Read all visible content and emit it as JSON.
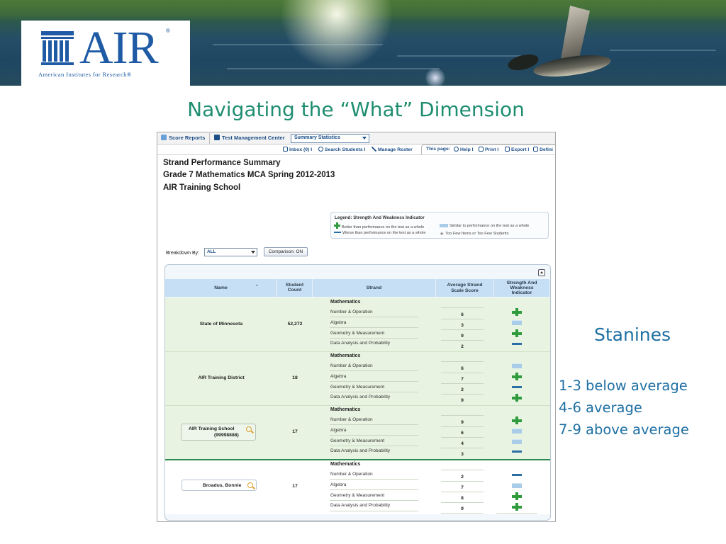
{
  "banner": {
    "logo_word": "AIR",
    "logo_registered": "®",
    "logo_subtitle": "American Institutes for Research®"
  },
  "slide": {
    "title": "Navigating the “What” Dimension",
    "stanines_heading": "Stanines",
    "stanine_ranges": [
      "1-3 below average",
      "4-6 average",
      "7-9 above average"
    ]
  },
  "app": {
    "nav": {
      "score_reports": "Score Reports",
      "test_management": "Test Management Center",
      "report_select": "Summary Statistics"
    },
    "toolbar": {
      "inbox": "Inbox (0) I",
      "search_students": "Search Students I",
      "manage_roster": "Manage Roster",
      "this_page": "This page:",
      "help": "Help I",
      "print": "Print I",
      "export": "Export I",
      "definitions": "Defini"
    },
    "report": {
      "title": "Strand Performance Summary",
      "subtitle": "Grade 7 Mathematics MCA Spring 2012-2013",
      "school": "AIR Training School"
    },
    "legend": {
      "title": "Legend: Strength And Weakness Indicator",
      "better": "Better than performance on the test as a whole",
      "similar": "Similar to performance on the test as a whole",
      "worse": "Worse than performance on the test as a whole",
      "too_few": "Too Few Items or Too Few Students"
    },
    "controls": {
      "breakdown_label": "Breakdown By:",
      "breakdown_value": "ALL",
      "comparison_button": "Comparison: ON"
    },
    "columns": {
      "name": "Name",
      "student_count_1": "Student",
      "student_count_2": "Count",
      "strand": "Strand",
      "avg_1": "Average Strand",
      "avg_2": "Scale Score",
      "sw_1": "Strength And",
      "sw_2": "Weakness",
      "sw_3": "Indicator"
    },
    "groups": [
      {
        "name": "State of Minnesota",
        "code": "",
        "count": "52,272",
        "subject": "Mathematics",
        "rows": [
          {
            "strand": "Number & Operation",
            "score": "6",
            "indicator": "better"
          },
          {
            "strand": "Algebra",
            "score": "3",
            "indicator": "similar"
          },
          {
            "strand": "Geometry & Measurement",
            "score": "9",
            "indicator": "better"
          },
          {
            "strand": "Data Analysis and Probability",
            "score": "2",
            "indicator": "worse"
          }
        ]
      },
      {
        "name": "AIR Training District",
        "code": "",
        "count": "18",
        "subject": "Mathematics",
        "rows": [
          {
            "strand": "Number & Operation",
            "score": "6",
            "indicator": "similar"
          },
          {
            "strand": "Algebra",
            "score": "7",
            "indicator": "better"
          },
          {
            "strand": "Geometry & Measurement",
            "score": "2",
            "indicator": "worse"
          },
          {
            "strand": "Data Analysis and Probability",
            "score": "9",
            "indicator": "better"
          }
        ]
      },
      {
        "name": "AIR Training School",
        "code": "(99998888)",
        "count": "17",
        "subject": "Mathematics",
        "rows": [
          {
            "strand": "Number & Operation",
            "score": "9",
            "indicator": "better"
          },
          {
            "strand": "Algebra",
            "score": "6",
            "indicator": "similar"
          },
          {
            "strand": "Geometry & Measurement",
            "score": "4",
            "indicator": "similar"
          },
          {
            "strand": "Data Analysis and Probability",
            "score": "3",
            "indicator": "worse"
          }
        ]
      },
      {
        "name": "Broadus, Bonnie",
        "code": "",
        "count": "17",
        "subject": "Mathematics",
        "rows": [
          {
            "strand": "Number & Operation",
            "score": "2",
            "indicator": "worse"
          },
          {
            "strand": "Algebra",
            "score": "7",
            "indicator": "similar"
          },
          {
            "strand": "Geometry & Measurement",
            "score": "8",
            "indicator": "better"
          },
          {
            "strand": "Data Analysis and Probability",
            "score": "9",
            "indicator": "better"
          }
        ]
      }
    ]
  }
}
